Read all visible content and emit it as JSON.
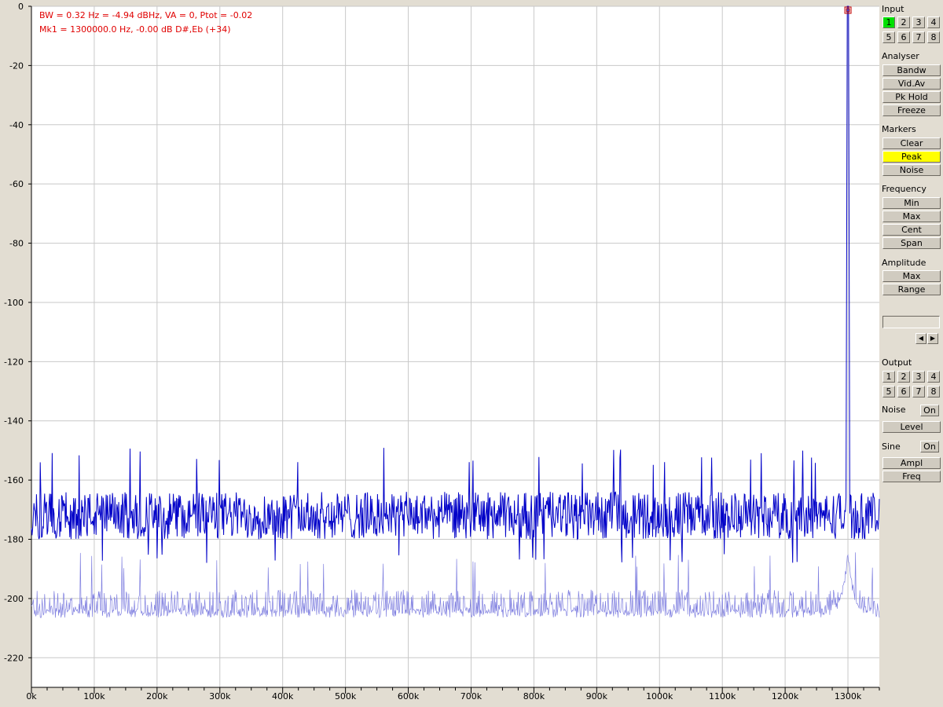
{
  "readout": {
    "line1": "BW = 0.32 Hz = -4.94 dBHz, VA = 0, Ptot = -0.02",
    "line2": "Mk1 = 1300000.0 Hz,   -0.00 dB  D#,Eb (+34)"
  },
  "panel": {
    "input": {
      "title": "Input",
      "buttons": [
        "1",
        "2",
        "3",
        "4",
        "5",
        "6",
        "7",
        "8"
      ],
      "active": "1"
    },
    "analyser": {
      "title": "Analyser",
      "buttons": [
        "Bandw",
        "Vid.Av",
        "Pk Hold",
        "Freeze"
      ]
    },
    "markers": {
      "title": "Markers",
      "buttons": [
        "Clear",
        "Peak",
        "Noise"
      ],
      "active": "Peak"
    },
    "frequency": {
      "title": "Frequency",
      "buttons": [
        "Min",
        "Max",
        "Cent",
        "Span"
      ]
    },
    "amplitude": {
      "title": "Amplitude",
      "buttons": [
        "Max",
        "Range"
      ]
    },
    "output": {
      "title": "Output",
      "buttons": [
        "1",
        "2",
        "3",
        "4",
        "5",
        "6",
        "7",
        "8"
      ]
    },
    "noise": {
      "title": "Noise",
      "toggle": "On",
      "buttons": [
        "Level"
      ]
    },
    "sine": {
      "title": "Sine",
      "toggle": "On",
      "buttons": [
        "Ampl",
        "Freq"
      ]
    },
    "arrow_left": "◀",
    "arrow_right": "▶"
  },
  "colors": {
    "background": "#e2ddd2",
    "plot_bg": "#ffffff",
    "grid": "#c8c8c8",
    "trace_main": "#0000c8",
    "trace_avg": "#8080e0",
    "readout_text": "#e00000",
    "marker": "#c00000"
  },
  "chart_data": {
    "type": "line",
    "xlim": [
      0,
      1350000
    ],
    "ylim": [
      -230,
      0
    ],
    "x_ticks": [
      0,
      100000,
      200000,
      300000,
      400000,
      500000,
      600000,
      700000,
      800000,
      900000,
      1000000,
      1100000,
      1200000,
      1300000
    ],
    "x_tick_labels": [
      "0k",
      "100k",
      "200k",
      "300k",
      "400k",
      "500k",
      "600k",
      "700k",
      "800k",
      "900k",
      "1000k",
      "1100k",
      "1200k",
      "1300k"
    ],
    "y_ticks": [
      0,
      -20,
      -40,
      -60,
      -80,
      -100,
      -120,
      -140,
      -160,
      -180,
      -200,
      -220
    ],
    "y_tick_labels": [
      "0",
      "-20",
      "-40",
      "-60",
      "-80",
      "-100",
      "-120",
      "-140",
      "-160",
      "-180",
      "-200",
      "-220"
    ],
    "grid": true,
    "marker": {
      "x": 1300000,
      "y": 0
    },
    "series": [
      {
        "peak_x": 1300000,
        "peak_y": 0,
        "noise_floor_mean": -172,
        "noise_floor_min": -188,
        "noise_floor_max": -149
      },
      {
        "peak_x": 1300000,
        "peak_y": -185,
        "noise_floor_mean": -205,
        "noise_floor_min": -216,
        "noise_floor_max": -184
      }
    ]
  }
}
